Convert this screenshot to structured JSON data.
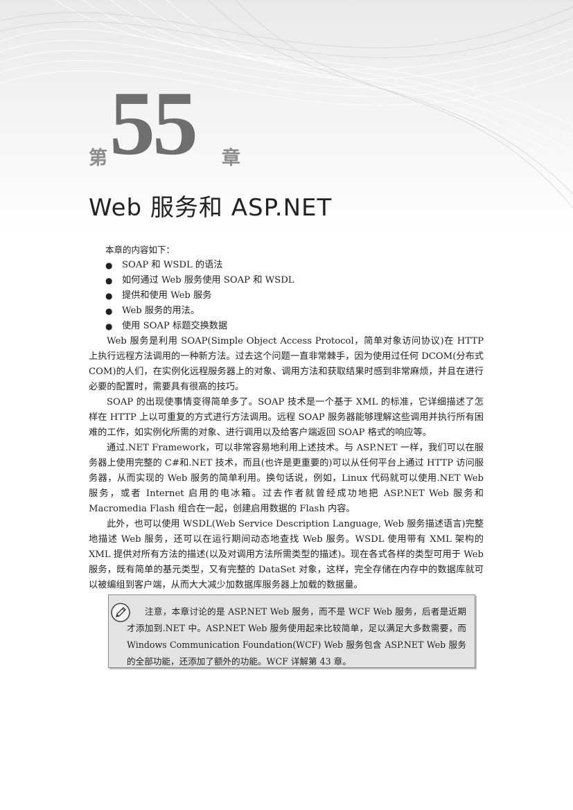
{
  "chapter": {
    "prefix": "第",
    "number": "55",
    "suffix": "章",
    "title": "Web 服务和 ASP.NET"
  },
  "intro": "本章的内容如下：",
  "bullets": [
    "SOAP 和 WSDL 的语法",
    "如何通过 Web 服务使用 SOAP 和 WSDL",
    "提供和使用 Web 服务",
    "Web 服务的用法。",
    "使用 SOAP 标题交换数据"
  ],
  "paragraphs": [
    "Web 服务是利用 SOAP(Simple Object Access Protocol，简单对象访问协议)在 HTTP 上执行远程方法调用的一种新方法。过去这个问题一直非常棘手，因为使用过任何 DCOM(分布式 COM)的人们，在实例化远程服务器上的对象、调用方法和获取结果时感到非常麻烦，并且在进行必要的配置时，需要具有很高的技巧。",
    "SOAP 的出现使事情变得简单多了。SOAP 技术是一个基于 XML 的标准，它详细描述了怎样在 HTTP 上以可重复的方式进行方法调用。远程 SOAP 服务器能够理解这些调用并执行所有困难的工作，如实例化所需的对象、进行调用以及给客户端返回 SOAP 格式的响应等。",
    "通过.NET Framework，可以非常容易地利用上述技术。与 ASP.NET 一样，我们可以在服务器上使用完整的 C#和.NET 技术，而且(也许是更重要的)可以从任何平台上通过 HTTP 访问服务器，从而实现的 Web 服务的简单利用。换句话说，例如，Linux 代码就可以使用.NET Web 服务，或者 Internet 启用的电冰箱。过去作者就曾经成功地把 ASP.NET Web 服务和 Macromedia Flash 组合在一起，创建启用数据的 Flash 内容。",
    "此外，也可以使用 WSDL(Web Service Description Language, Web 服务描述语言)完整地描述 Web 服务，还可以在运行期间动态地查找 Web 服务。WSDL 使用带有 XML 架构的 XML 提供对所有方法的描述(以及对调用方法所需类型的描述)。现在各式各样的类型可用于 Web 服务，既有简单的基元类型，又有完整的 DataSet 对象，这样，完全存储在内存中的数据库就可以被编组到客户端，从而大大减少加数据库服务器上加载的数据量。"
  ],
  "note": {
    "icon": "pencil-icon",
    "text": "注意，本章讨论的是 ASP.NET Web 服务，而不是 WCF Web 服务，后者是近期才添加到.NET 中。ASP.NET Web 服务使用起来比较简单，足以满足大多数需要，而 Windows Communication Foundation(WCF) Web 服务包含 ASP.NET Web 服务的全部功能，还添加了额外的功能。WCF 详解第 43 章。"
  },
  "colors": {
    "chapter_number": "#6e6e6e",
    "chapter_glyph": "#8c8c8c",
    "note_bg": "#e3e3e3",
    "note_border": "#8a8a8a"
  }
}
